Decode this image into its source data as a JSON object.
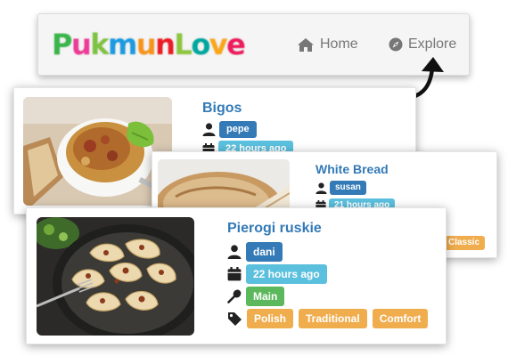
{
  "navbar": {
    "brand": "PukmunLove",
    "brand_colors": [
      "#39b54a",
      "#ee3b97",
      "#7fc241",
      "#1c9be0",
      "#f7941d",
      "#ec1c24",
      "#8dc63f",
      "#00a79d",
      "#f9a61a",
      "#ed1c5c"
    ],
    "home_label": "Home",
    "explore_label": "Explore",
    "link_color": "#777777"
  },
  "cards": [
    {
      "title": "Bigos",
      "author": "pepe",
      "time": "22 hours ago"
    },
    {
      "title": "White Bread",
      "author": "susan",
      "time": "21 hours ago",
      "tag": "Classic"
    },
    {
      "title": "Pierogi ruskie",
      "author": "dani",
      "time": "22 hours ago",
      "course": "Main",
      "tags": [
        "Polish",
        "Traditional",
        "Comfort"
      ]
    }
  ],
  "colors": {
    "primary": "#337ab7",
    "info": "#5bc0de",
    "success": "#5cb85c",
    "warning": "#f0ad4e"
  }
}
